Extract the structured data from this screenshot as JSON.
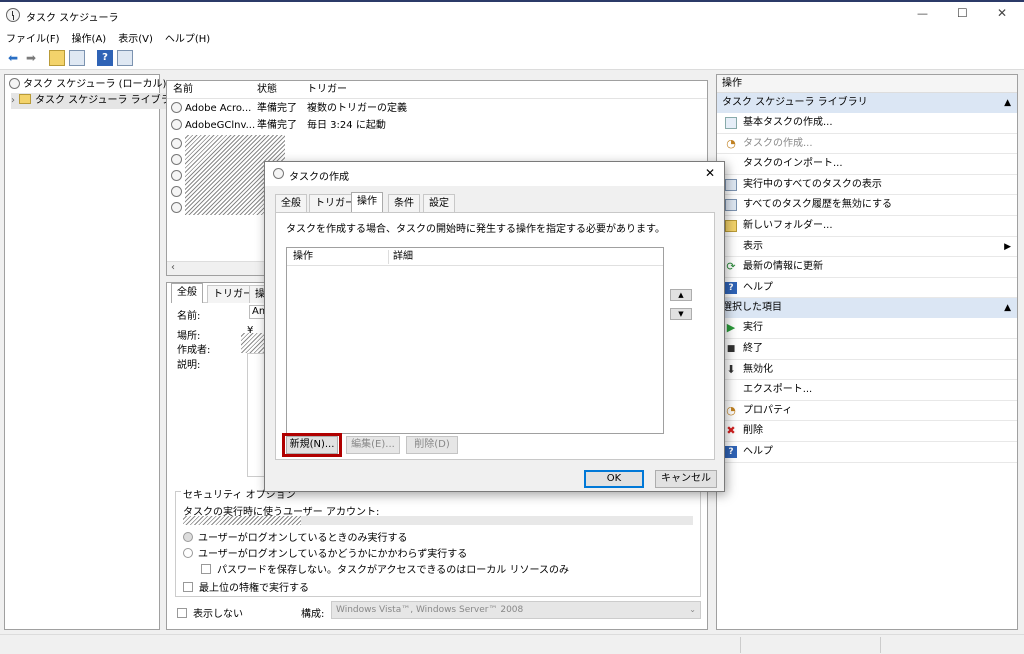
{
  "window": {
    "title": "タスク スケジューラ",
    "minimize": "—",
    "maximize": "☐",
    "close": "✕"
  },
  "menu": [
    "ファイル(F)",
    "操作(A)",
    "表示(V)",
    "ヘルプ(H)"
  ],
  "tree": {
    "root": "タスク スケジューラ (ローカル)",
    "library": "タスク スケジューラ ライブラリ"
  },
  "task_list": {
    "columns": [
      "名前",
      "状態",
      "トリガー"
    ],
    "rows": [
      {
        "name": "Adobe Acro...",
        "status": "準備完了",
        "trigger": "複数のトリガーの定義"
      },
      {
        "name": "AdobeGClnv...",
        "status": "準備完了",
        "trigger": "毎日 3:24 に起動"
      }
    ]
  },
  "details": {
    "tabs": [
      "全般",
      "トリガー",
      "操作"
    ],
    "name_label": "名前:",
    "name_value": "Am",
    "location_label": "場所:",
    "location_value": "¥",
    "author_label": "作成者:",
    "description_label": "説明:",
    "security_group": "セキュリティ オプション",
    "run_as_label": "タスクの実行時に使うユーザー アカウント:",
    "radio_logged_on": "ユーザーがログオンしているときのみ実行する",
    "radio_whether": "ユーザーがログオンしているかどうかにかかわらず実行する",
    "check_no_password": "パスワードを保存しない。タスクがアクセスできるのはローカル リソースのみ",
    "check_highest": "最上位の特権で実行する",
    "check_hidden": "表示しない",
    "config_label": "構成:",
    "config_value": "Windows Vista™, Windows Server™ 2008"
  },
  "actions_pane": {
    "header": "操作",
    "section1_title": "タスク スケジューラ ライブラリ",
    "section1_items": [
      {
        "label": "基本タスクの作成...",
        "icon": "wizard-icon"
      },
      {
        "label": "タスクの作成...",
        "icon": "create-task-icon"
      },
      {
        "label": "タスクのインポート...",
        "icon": "import-icon"
      },
      {
        "label": "実行中のすべてのタスクの表示",
        "icon": "running-tasks-icon"
      },
      {
        "label": "すべてのタスク履歴を無効にする",
        "icon": "history-icon"
      },
      {
        "label": "新しいフォルダー...",
        "icon": "folder-icon"
      },
      {
        "label": "表示",
        "icon": "view-icon"
      },
      {
        "label": "最新の情報に更新",
        "icon": "refresh-icon"
      },
      {
        "label": "ヘルプ",
        "icon": "help-icon"
      }
    ],
    "section2_title": "選択した項目",
    "section2_items": [
      {
        "label": "実行",
        "icon": "run-icon"
      },
      {
        "label": "終了",
        "icon": "stop-icon"
      },
      {
        "label": "無効化",
        "icon": "disable-icon"
      },
      {
        "label": "エクスポート...",
        "icon": "export-icon"
      },
      {
        "label": "プロパティ",
        "icon": "properties-icon"
      },
      {
        "label": "削除",
        "icon": "delete-icon"
      },
      {
        "label": "ヘルプ",
        "icon": "help-icon"
      }
    ]
  },
  "dialog": {
    "title": "タスクの作成",
    "tabs": [
      "全般",
      "トリガー",
      "操作",
      "条件",
      "設定"
    ],
    "active_tab": "操作",
    "instruction": "タスクを作成する場合、タスクの開始時に発生する操作を指定する必要があります。",
    "columns": [
      "操作",
      "詳細"
    ],
    "new_button": "新規(N)...",
    "edit_button": "編集(E)...",
    "delete_button": "削除(D)",
    "ok_button": "OK",
    "cancel_button": "キャンセル",
    "highlight_color": "#b00000"
  }
}
